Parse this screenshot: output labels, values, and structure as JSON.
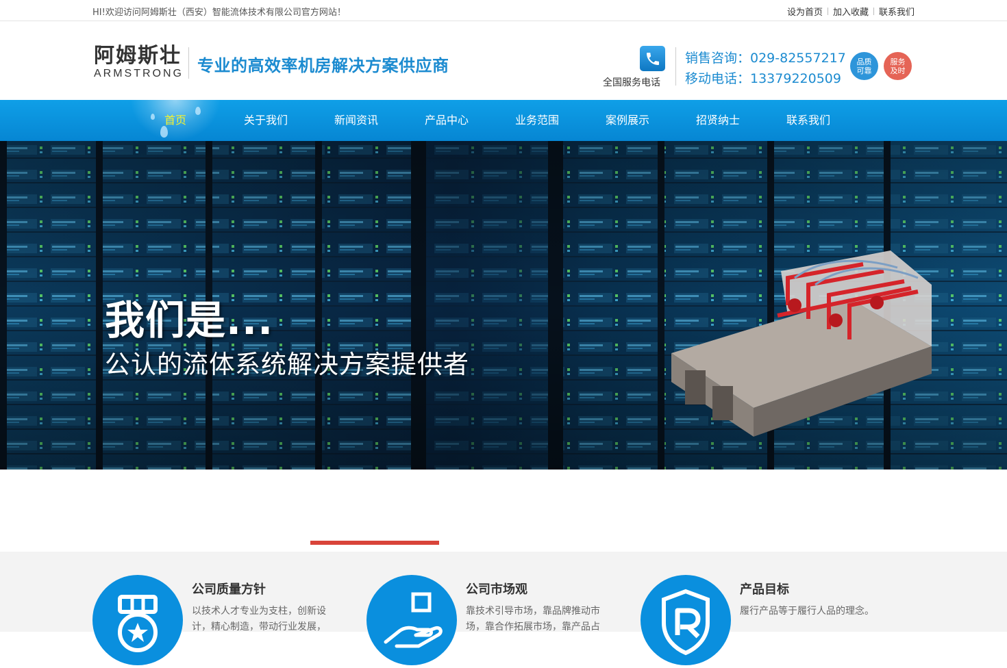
{
  "topbar": {
    "welcome": "HI!欢迎访问阿姆斯壮（西安）智能流体技术有限公司官方网站！",
    "links": [
      "设为首页",
      "加入收藏",
      "联系我们"
    ]
  },
  "header": {
    "logo_cn": "阿姆斯壮",
    "logo_en": "ARMSTRONG",
    "slogan": "专业的高效率机房解决方案供应商",
    "service_label": "全国服务电话",
    "sales_line": "销售咨询：029-82557217",
    "mobile_line": "移动电话：13379220509",
    "badge_quality": [
      "品质",
      "可靠"
    ],
    "badge_service": [
      "服务",
      "及时"
    ]
  },
  "nav": {
    "items": [
      "首页",
      "关于我们",
      "新闻资讯",
      "产品中心",
      "业务范围",
      "案例展示",
      "招贤纳士",
      "联系我们"
    ],
    "active_index": 0
  },
  "banner": {
    "headline": "我们是...",
    "subline": "公认的流体系统解决方案提供者"
  },
  "features": [
    {
      "title": "公司质量方针",
      "desc": "以技术人才专业为支柱，创新设计，精心制造，带动行业发展，",
      "icon": "medal-icon"
    },
    {
      "title": "公司市场观",
      "desc": "靠技术引导市场，靠品牌推动市场，靠合作拓展市场，靠产品占",
      "icon": "hand-box-icon"
    },
    {
      "title": "产品目标",
      "desc": "履行产品等于履行人品的理念。",
      "icon": "registered-shield-icon"
    }
  ],
  "colors": {
    "brand_blue": "#0a8fde",
    "nav_active": "#f4f230",
    "accent_red": "#d9443a"
  }
}
